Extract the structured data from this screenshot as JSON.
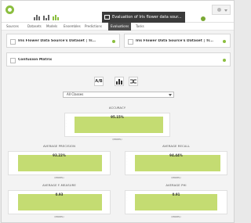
{
  "nav": {
    "items": [
      "Sources",
      "Datasets",
      "Models",
      "Ensembles",
      "Predictions",
      "Evaluations",
      "Tasks"
    ],
    "active": "Evaluations"
  },
  "breadcrumb": {
    "title": "Evaluation of Iris flower data sour..."
  },
  "cards": {
    "left_title": "Iris Flower Data Source's Dataset | Tr...",
    "right_title": "Iris Flower Data Source's Dataset | Tr...",
    "matrix_title": "Confusion Matrix"
  },
  "tools": {
    "ab_label": "A/B"
  },
  "select": {
    "value": "All Classes"
  },
  "metrics": {
    "accuracy": {
      "label": "ACCURACY",
      "value": "95.15%",
      "foot": "(MODEL)",
      "level": 0.9515
    },
    "precision": {
      "label": "AVERAGE PRECISION",
      "value": "93.22%",
      "foot": "(MODEL)",
      "level": 0.9322
    },
    "recall": {
      "label": "AVERAGE RECALL",
      "value": "94.44%",
      "foot": "(MODEL)",
      "level": 0.9444
    },
    "fmeasure": {
      "label": "AVERAGE F-MEASURE",
      "value": "0.93",
      "foot": "(MODEL)",
      "level": 0.93
    },
    "phi": {
      "label": "AVERAGE PHI",
      "value": "0.91",
      "foot": "(MODEL)",
      "level": 0.91
    }
  },
  "colors": {
    "accent": "#8bbe3f",
    "bar": "#c4dc72",
    "breadcrumb_bg": "#3b3b3b"
  }
}
